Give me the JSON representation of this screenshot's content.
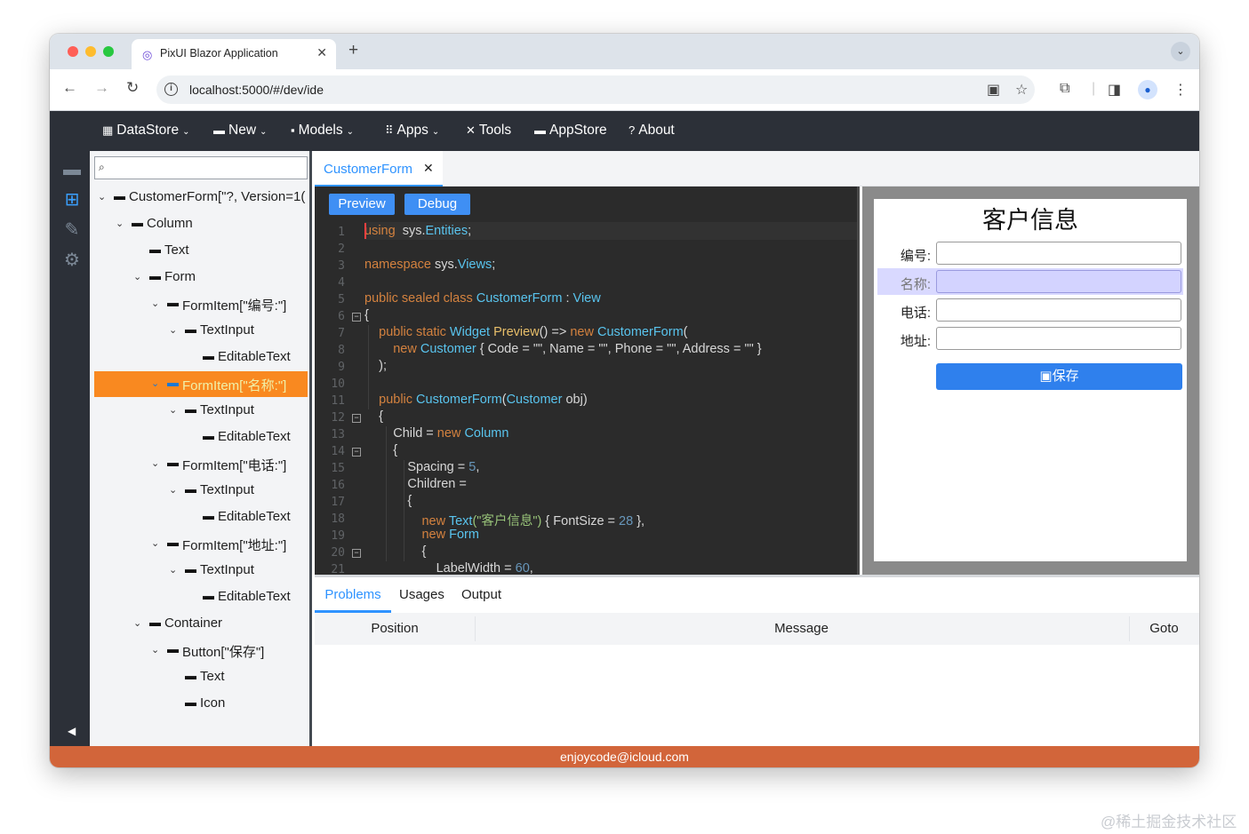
{
  "browser": {
    "tab_title": "PixUI Blazor Application",
    "tab_close": "✕",
    "new_tab": "+",
    "url": "localhost:5000/#/dev/ide",
    "tabstrip_menu": "⌄"
  },
  "menu": {
    "items": [
      {
        "icon": "▦",
        "label": "DataStore",
        "caret": "⌄"
      },
      {
        "icon": "▬",
        "label": "New",
        "caret": "⌄"
      },
      {
        "icon": "▪",
        "label": "Models",
        "caret": "⌄"
      },
      {
        "icon": "⠿",
        "label": "Apps",
        "caret": "⌄"
      },
      {
        "icon": "✕",
        "label": "Tools",
        "caret": ""
      },
      {
        "icon": "▬",
        "label": "AppStore",
        "caret": ""
      },
      {
        "icon": "?",
        "label": "About",
        "caret": ""
      }
    ]
  },
  "tree": {
    "search_placeholder": "",
    "items": [
      {
        "label": "CustomerForm[\"?, Version=1(",
        "depth": 0,
        "expanded": true
      },
      {
        "label": "Column",
        "depth": 1,
        "expanded": true
      },
      {
        "label": "Text",
        "depth": 2,
        "expanded": null
      },
      {
        "label": "Form",
        "depth": 2,
        "expanded": true
      },
      {
        "label": "FormItem[\"编号:\"]",
        "depth": 3,
        "expanded": true
      },
      {
        "label": "TextInput",
        "depth": 4,
        "expanded": true
      },
      {
        "label": "EditableText",
        "depth": 5,
        "expanded": null
      },
      {
        "label": "FormItem[\"名称:\"]",
        "depth": 3,
        "expanded": true,
        "selected": true
      },
      {
        "label": "TextInput",
        "depth": 4,
        "expanded": true
      },
      {
        "label": "EditableText",
        "depth": 5,
        "expanded": null
      },
      {
        "label": "FormItem[\"电话:\"]",
        "depth": 3,
        "expanded": true
      },
      {
        "label": "TextInput",
        "depth": 4,
        "expanded": true
      },
      {
        "label": "EditableText",
        "depth": 5,
        "expanded": null
      },
      {
        "label": "FormItem[\"地址:\"]",
        "depth": 3,
        "expanded": true
      },
      {
        "label": "TextInput",
        "depth": 4,
        "expanded": true
      },
      {
        "label": "EditableText",
        "depth": 5,
        "expanded": null
      },
      {
        "label": "Container",
        "depth": 2,
        "expanded": true
      },
      {
        "label": "Button[\"保存\"]",
        "depth": 3,
        "expanded": true
      },
      {
        "label": "Text",
        "depth": 4,
        "expanded": null
      },
      {
        "label": "Icon",
        "depth": 4,
        "expanded": null
      }
    ]
  },
  "editor": {
    "tab_label": "CustomerForm",
    "tab_close": "✕",
    "preview_label": "Preview",
    "debug_label": "Debug",
    "line_numbers": [
      "1",
      "2",
      "3",
      "4",
      "5",
      "6",
      "7",
      "8",
      "9",
      "10",
      "11",
      "12",
      "13",
      "14",
      "15",
      "16",
      "17",
      "18",
      "19",
      "20",
      "21"
    ],
    "lines": [
      [
        [
          "kw",
          "using"
        ],
        [
          "",
          "  sys."
        ],
        [
          "ty",
          "Entities"
        ],
        [
          "",
          ";"
        ]
      ],
      [],
      [
        [
          "kw",
          "namespace"
        ],
        [
          "",
          " sys."
        ],
        [
          "ty",
          "Views"
        ],
        [
          "",
          ";"
        ]
      ],
      [],
      [
        [
          "kw",
          "public sealed class "
        ],
        [
          "ty",
          "CustomerForm"
        ],
        [
          "",
          " : "
        ],
        [
          "ty",
          "View"
        ]
      ],
      [
        [
          "",
          "{"
        ]
      ],
      [
        [
          "",
          "    "
        ],
        [
          "kw",
          "public static "
        ],
        [
          "ty",
          "Widget "
        ],
        [
          "fn",
          "Preview"
        ],
        [
          "",
          "() => "
        ],
        [
          "kw",
          "new "
        ],
        [
          "ty",
          "CustomerForm"
        ],
        [
          "",
          "("
        ]
      ],
      [
        [
          "",
          "        "
        ],
        [
          "kw",
          "new "
        ],
        [
          "ty",
          "Customer"
        ],
        [
          "",
          " { Code = \"\", Name = \"\", Phone = \"\", Address = \"\" }"
        ]
      ],
      [
        [
          "",
          "    );"
        ]
      ],
      [],
      [
        [
          "",
          "    "
        ],
        [
          "kw",
          "public "
        ],
        [
          "ty",
          "CustomerForm"
        ],
        [
          "",
          "("
        ],
        [
          "ty",
          "Customer"
        ],
        [
          "",
          " obj)"
        ]
      ],
      [
        [
          "",
          "    {"
        ]
      ],
      [
        [
          "",
          "        Child = "
        ],
        [
          "kw",
          "new "
        ],
        [
          "ty",
          "Column"
        ]
      ],
      [
        [
          "",
          "        {"
        ]
      ],
      [
        [
          "",
          "            Spacing = "
        ],
        [
          "num",
          "5"
        ],
        [
          "",
          ","
        ]
      ],
      [
        [
          "",
          "            Children ="
        ]
      ],
      [
        [
          "",
          "            {"
        ]
      ],
      [
        [
          "",
          "                "
        ],
        [
          "kw",
          "new "
        ],
        [
          "ty",
          "Text"
        ],
        [
          "str",
          "(\"客户信息\")"
        ],
        [
          "",
          " { FontSize = "
        ],
        [
          "num",
          "28"
        ],
        [
          "",
          " },"
        ]
      ],
      [
        [
          "",
          "                "
        ],
        [
          "kw",
          "new "
        ],
        [
          "ty",
          "Form"
        ]
      ],
      [
        [
          "",
          "                {"
        ]
      ],
      [
        [
          "",
          "                    LabelWidth = "
        ],
        [
          "num",
          "60"
        ],
        [
          "",
          ","
        ]
      ]
    ]
  },
  "preview": {
    "title": "客户信息",
    "fields": [
      {
        "label": "编号:",
        "value": ""
      },
      {
        "label": "名称:",
        "value": "",
        "highlight": true
      },
      {
        "label": "电话:",
        "value": ""
      },
      {
        "label": "地址:",
        "value": ""
      }
    ],
    "save_icon": "💾",
    "save_label": "保存"
  },
  "bottom": {
    "tabs": [
      "Problems",
      "Usages",
      "Output"
    ],
    "active_tab": "Problems",
    "columns": [
      "Position",
      "Message",
      "Goto"
    ]
  },
  "status": {
    "text": "enjoycode@icloud.com"
  },
  "watermark": "@稀土掘金技术社区"
}
